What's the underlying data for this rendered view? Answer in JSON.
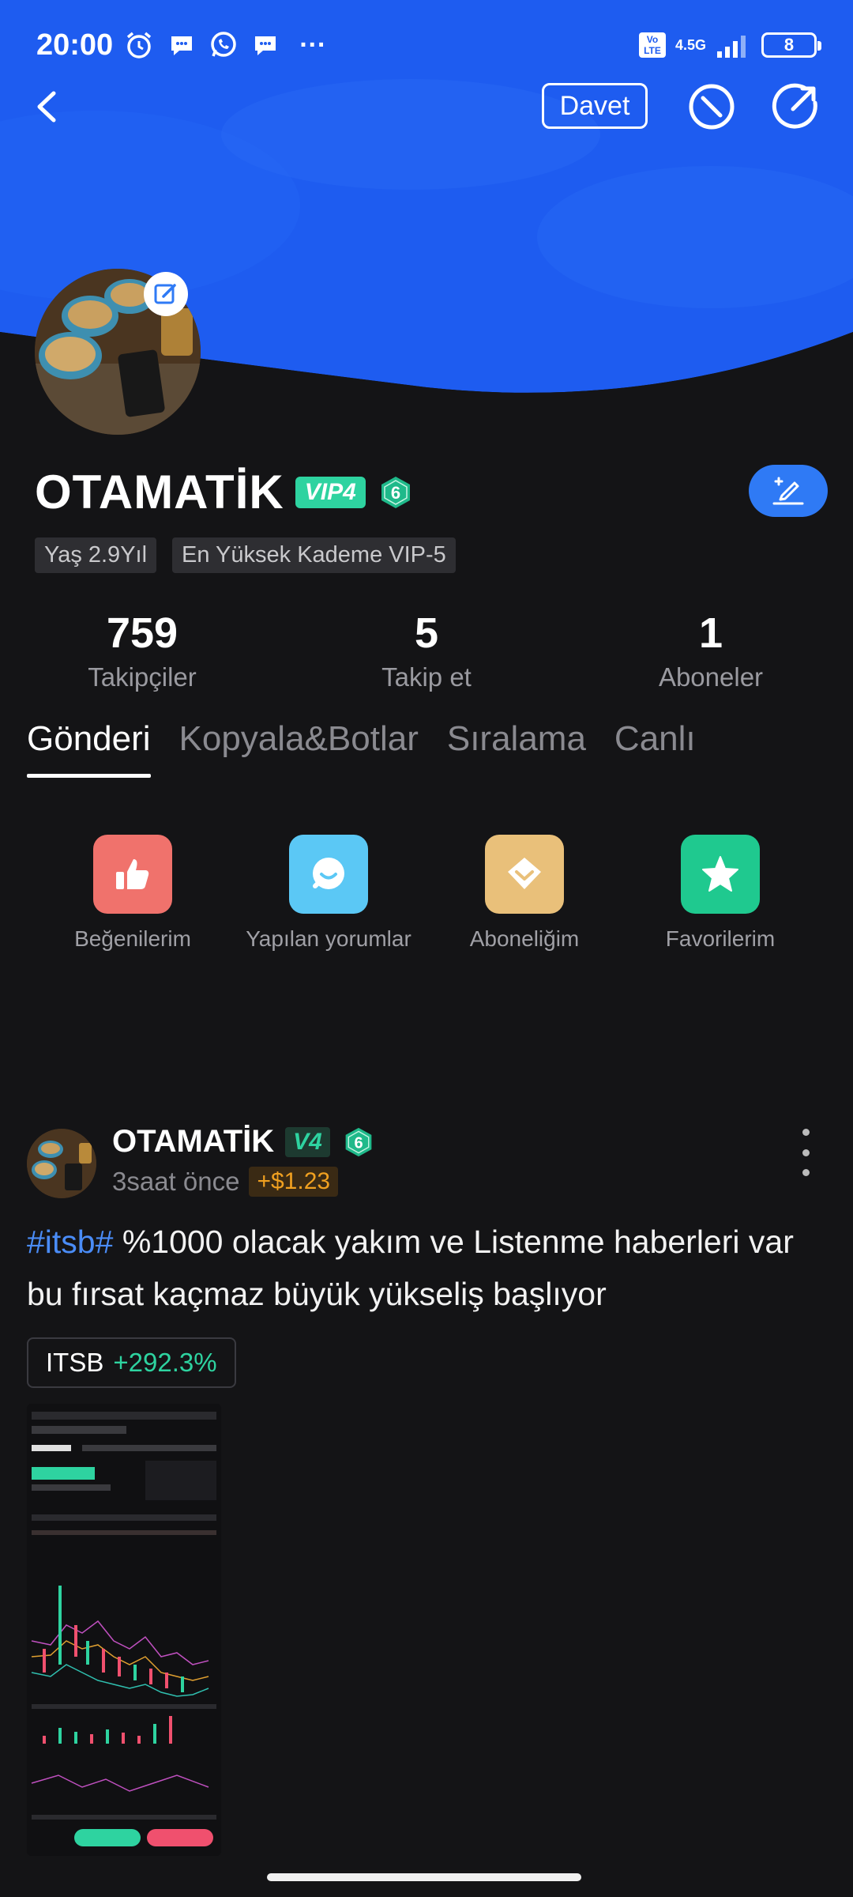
{
  "status_bar": {
    "time": "20:00",
    "network": "4.5G",
    "volte": "Vo LTE",
    "battery": "8",
    "more": "···"
  },
  "header": {
    "invite_label": "Davet"
  },
  "profile": {
    "name": "OTAMATİK",
    "vip_label": "VIP4",
    "level": "6",
    "tags": [
      "Yaş 2.9Yıl",
      "En Yüksek Kademe VIP-5"
    ],
    "stats": [
      {
        "value": "759",
        "label": "Takipçiler"
      },
      {
        "value": "5",
        "label": "Takip et"
      },
      {
        "value": "1",
        "label": "Aboneler"
      }
    ]
  },
  "tabs": [
    {
      "label": "Gönderi",
      "active": true
    },
    {
      "label": "Kopyala&Botlar",
      "active": false
    },
    {
      "label": "Sıralama",
      "active": false
    },
    {
      "label": "Canlı",
      "active": false
    }
  ],
  "shortcuts": [
    {
      "label": "Beğenilerim",
      "icon": "thumbs-up-icon",
      "color": "#f0726c"
    },
    {
      "label": "Yapılan yorumlar",
      "icon": "comment-icon",
      "color": "#5bc8f5"
    },
    {
      "label": "Aboneliğim",
      "icon": "subscription-icon",
      "color": "#e9c07a"
    },
    {
      "label": "Favorilerim",
      "icon": "star-icon",
      "color": "#1fc98f"
    }
  ],
  "post": {
    "author": "OTAMATİK",
    "vip_label": "V4",
    "level": "6",
    "time": "3saat önce",
    "pnl": "+$1.23",
    "hashtag": "#itsb#",
    "text": " %1000 olacak yakım ve Listenme haberleri var bu fırsat kaçmaz büyük yükseliş başlıyor",
    "ticker": "ITSB",
    "ticker_change": "+292.3%"
  },
  "colors": {
    "banner": "#1e5cf0",
    "background": "#141416",
    "accent": "#2f7af5",
    "positive": "#2ed3a0"
  }
}
